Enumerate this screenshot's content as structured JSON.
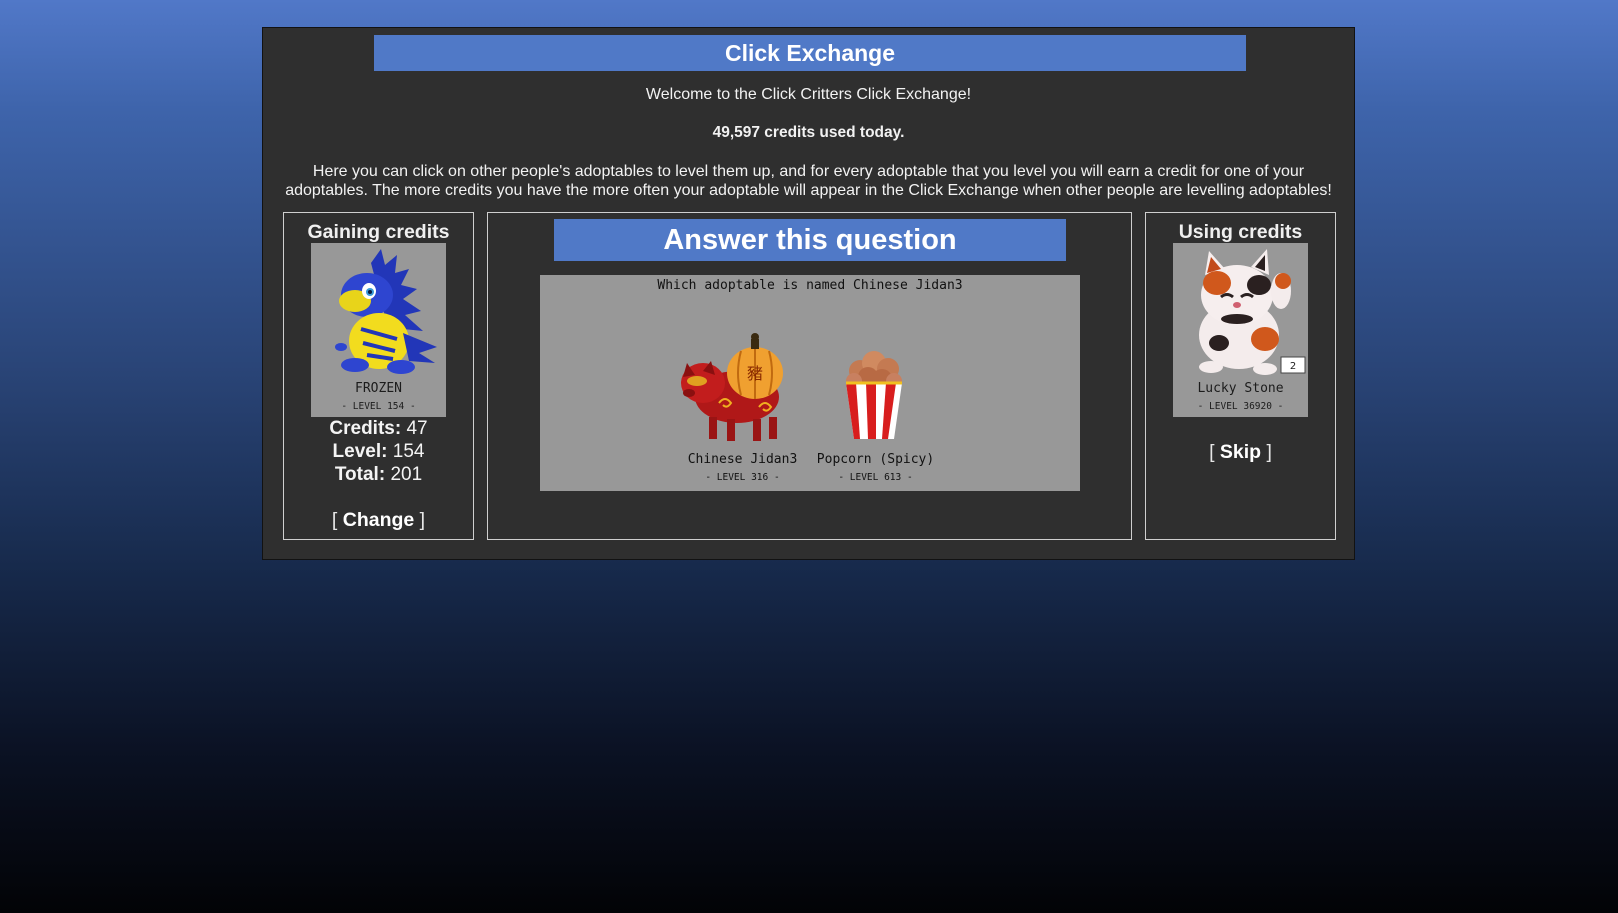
{
  "header": {
    "title": "Click Exchange",
    "welcome": "Welcome to the Click Critters Click Exchange!",
    "credits_used": "49,597 credits used today.",
    "intro": "Here you can click on other people's adoptables to level them up, and for every adoptable that you level you will earn a credit for one of your adoptables. The more credits you have the more often your adoptable will appear in the Click Exchange when other people are levelling adoptables!"
  },
  "gaining": {
    "heading": "Gaining credits",
    "adoptable": {
      "name": "FROZEN",
      "level": "- LEVEL 154 -"
    },
    "credits_label": "Credits:",
    "credits_value": "47",
    "level_label": "Level:",
    "level_value": "154",
    "total_label": "Total:",
    "total_value": "201",
    "bracket_open": "[",
    "change_label": "Change",
    "bracket_close": "]"
  },
  "question": {
    "heading": "Answer this question",
    "prompt": "Which adoptable is named Chinese Jidan3",
    "options": [
      {
        "name": "Chinese Jidan3",
        "level": "- LEVEL 316 -"
      },
      {
        "name": "Popcorn (Spicy)",
        "level": "- LEVEL 613 -"
      }
    ]
  },
  "using": {
    "heading": "Using credits",
    "adoptable": {
      "name": "Lucky Stone",
      "level": "- LEVEL 36920 -"
    },
    "bracket_open": "[",
    "skip_label": "Skip",
    "bracket_close": "]"
  },
  "colors": {
    "accent_blue": "#5079c7",
    "panel_bg": "#2f2f2f",
    "card_bg": "#989898"
  }
}
